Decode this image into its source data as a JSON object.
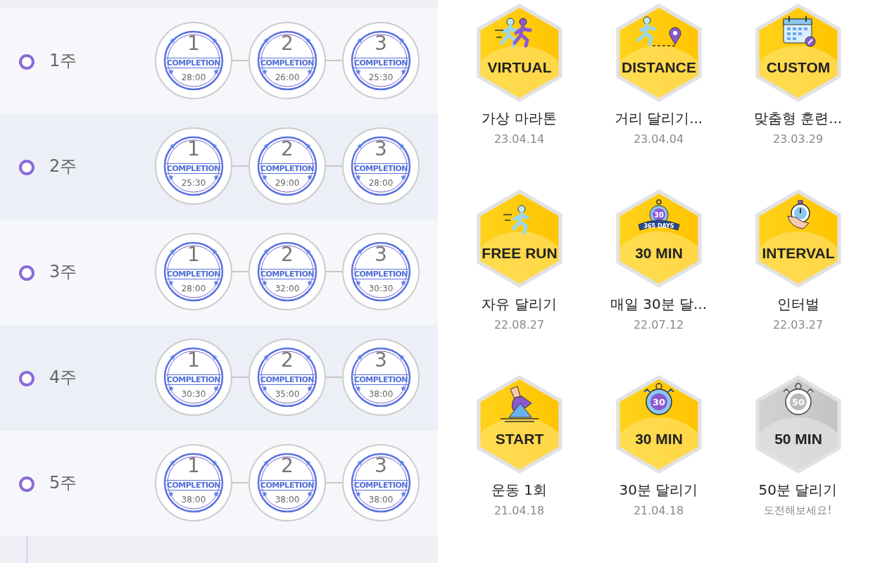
{
  "weeks": [
    {
      "label": "1주",
      "stamps": [
        {
          "number": "1",
          "label": "COMPLETION",
          "time": "28:00"
        },
        {
          "number": "2",
          "label": "COMPLETION",
          "time": "26:00"
        },
        {
          "number": "3",
          "label": "COMPLETION",
          "time": "25:30"
        }
      ]
    },
    {
      "label": "2주",
      "stamps": [
        {
          "number": "1",
          "label": "COMPLETION",
          "time": "25:30"
        },
        {
          "number": "2",
          "label": "COMPLETION",
          "time": "29:00"
        },
        {
          "number": "3",
          "label": "COMPLETION",
          "time": "28:00"
        }
      ]
    },
    {
      "label": "3주",
      "stamps": [
        {
          "number": "1",
          "label": "COMPLETION",
          "time": "28:00"
        },
        {
          "number": "2",
          "label": "COMPLETION",
          "time": "32:00"
        },
        {
          "number": "3",
          "label": "COMPLETION",
          "time": "30:30"
        }
      ]
    },
    {
      "label": "4주",
      "stamps": [
        {
          "number": "1",
          "label": "COMPLETION",
          "time": "30:30"
        },
        {
          "number": "2",
          "label": "COMPLETION",
          "time": "35:00"
        },
        {
          "number": "3",
          "label": "COMPLETION",
          "time": "38:00"
        }
      ]
    },
    {
      "label": "5주",
      "stamps": [
        {
          "number": "1",
          "label": "COMPLETION",
          "time": "38:00"
        },
        {
          "number": "2",
          "label": "COMPLETION",
          "time": "38:00"
        },
        {
          "number": "3",
          "label": "COMPLETION",
          "time": "38:00"
        }
      ]
    }
  ],
  "badges": [
    {
      "kind": "runners",
      "badge_text": "VIRTUAL",
      "title": "가상 마라톤",
      "subtitle": "23.04.14",
      "earned": true
    },
    {
      "kind": "distance",
      "badge_text": "DISTANCE",
      "title": "거리 달리기...",
      "subtitle": "23.04.04",
      "earned": true
    },
    {
      "kind": "calendar",
      "badge_text": "CUSTOM",
      "title": "맞춤형 훈련...",
      "subtitle": "23.03.29",
      "earned": true
    },
    {
      "kind": "runner",
      "badge_text": "FREE RUN",
      "title": "자유 달리기",
      "subtitle": "22.08.27",
      "earned": true
    },
    {
      "kind": "daily",
      "badge_text": "30 MIN",
      "icon_text": "30",
      "ribbon_text": "365 DAYS",
      "title": "매일 30분 달...",
      "subtitle": "22.07.12",
      "earned": true
    },
    {
      "kind": "hand",
      "badge_text": "INTERVAL",
      "title": "인터벌",
      "subtitle": "22.03.27",
      "earned": true
    },
    {
      "kind": "shoe",
      "badge_text": "START",
      "title": "운동 1회",
      "subtitle": "21.04.18",
      "earned": true
    },
    {
      "kind": "stopwatch",
      "badge_text": "30 MIN",
      "icon_text": "30",
      "title": "30분 달리기",
      "subtitle": "21.04.18",
      "earned": true
    },
    {
      "kind": "stopwatch",
      "badge_text": "50 MIN",
      "icon_text": "50",
      "title": "50분 달리기",
      "subtitle": "도전해보세요!",
      "earned": false
    }
  ]
}
